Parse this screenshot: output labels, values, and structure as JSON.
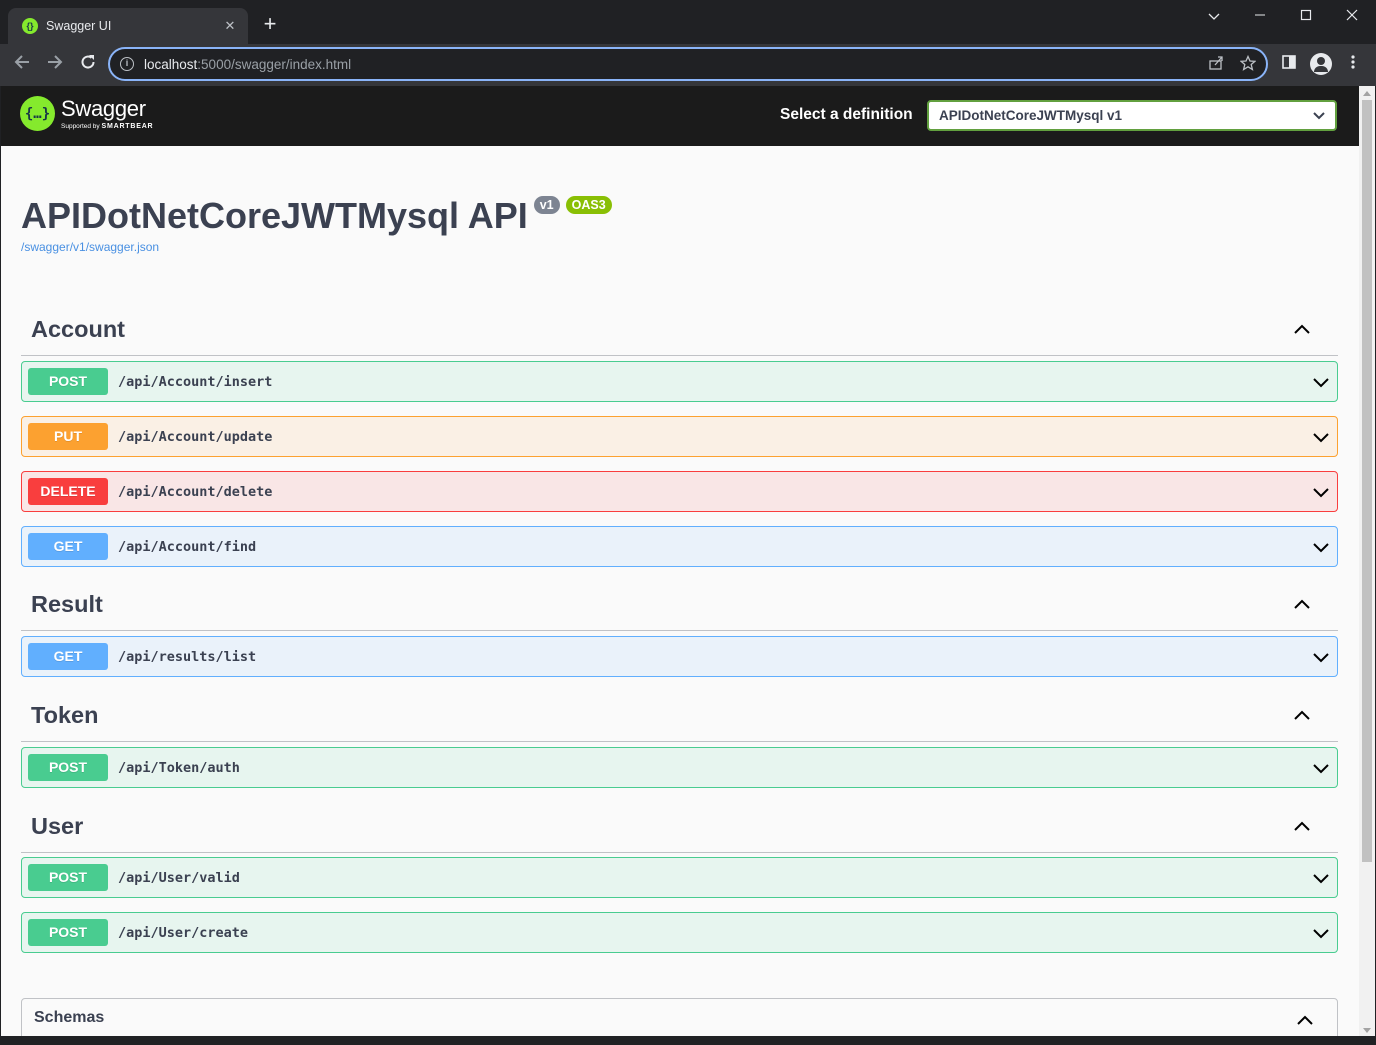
{
  "browser": {
    "tab_title": "Swagger UI",
    "tab_close": "✕",
    "new_tab": "+",
    "url_host": "localhost",
    "url_rest": ":5000/swagger/index.html"
  },
  "swagger": {
    "logo_mark": "{…}",
    "logo_name": "Swagger",
    "logo_sub_prefix": "Supported by",
    "logo_sub_brand": "SMARTBEAR",
    "definition_label": "Select a definition",
    "definition_selected": "APIDotNetCoreJWTMysql v1"
  },
  "info": {
    "title": "APIDotNetCoreJWTMysql API",
    "version_badge": "v1",
    "oas_badge": "OAS3",
    "spec_link": "/swagger/v1/swagger.json"
  },
  "tags": [
    {
      "name": "Account",
      "operations": [
        {
          "method": "POST",
          "path": "/api/Account/insert"
        },
        {
          "method": "PUT",
          "path": "/api/Account/update"
        },
        {
          "method": "DELETE",
          "path": "/api/Account/delete"
        },
        {
          "method": "GET",
          "path": "/api/Account/find"
        }
      ]
    },
    {
      "name": "Result",
      "operations": [
        {
          "method": "GET",
          "path": "/api/results/list"
        }
      ]
    },
    {
      "name": "Token",
      "operations": [
        {
          "method": "POST",
          "path": "/api/Token/auth"
        }
      ]
    },
    {
      "name": "User",
      "operations": [
        {
          "method": "POST",
          "path": "/api/User/valid"
        },
        {
          "method": "POST",
          "path": "/api/User/create"
        }
      ]
    }
  ],
  "schemas": {
    "title": "Schemas"
  },
  "colors": {
    "post": "#49cc90",
    "put": "#fca130",
    "delete": "#f93e3e",
    "get": "#61affe",
    "swagger_green": "#85ea2d",
    "topbar": "#1b1b1b"
  }
}
